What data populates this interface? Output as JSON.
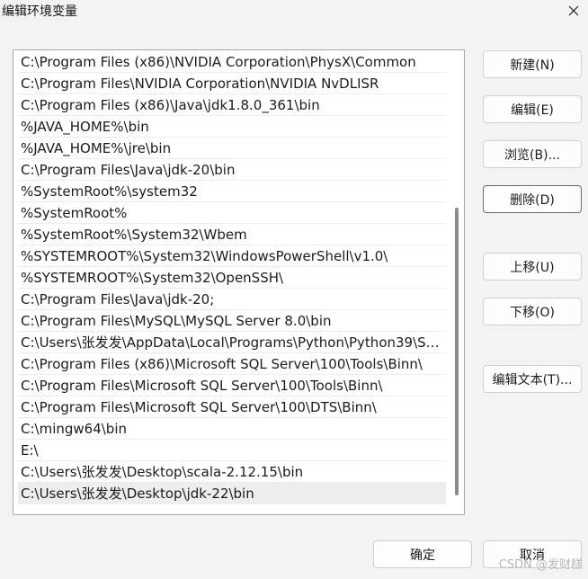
{
  "window": {
    "title": "编辑环境变量"
  },
  "paths": [
    "C:\\Program Files (x86)\\NVIDIA Corporation\\PhysX\\Common",
    "C:\\Program Files\\NVIDIA Corporation\\NVIDIA NvDLISR",
    "C:\\Program Files (x86)\\Java\\jdk1.8.0_361\\bin",
    "%JAVA_HOME%\\bin",
    "%JAVA_HOME%\\jre\\bin",
    "C:\\Program Files\\Java\\jdk-20\\bin",
    "%SystemRoot%\\system32",
    "%SystemRoot%",
    "%SystemRoot%\\System32\\Wbem",
    "%SYSTEMROOT%\\System32\\WindowsPowerShell\\v1.0\\",
    "%SYSTEMROOT%\\System32\\OpenSSH\\",
    "C:\\Program Files\\Java\\jdk-20;",
    "C:\\Program Files\\MySQL\\MySQL Server 8.0\\bin",
    "C:\\Users\\张发发\\AppData\\Local\\Programs\\Python\\Python39\\Sc...",
    "C:\\Program Files (x86)\\Microsoft SQL Server\\100\\Tools\\Binn\\",
    "C:\\Program Files\\Microsoft SQL Server\\100\\Tools\\Binn\\",
    "C:\\Program Files\\Microsoft SQL Server\\100\\DTS\\Binn\\",
    "C:\\mingw64\\bin",
    "E:\\",
    "C:\\Users\\张发发\\Desktop\\scala-2.12.15\\bin",
    "C:\\Users\\张发发\\Desktop\\jdk-22\\bin"
  ],
  "buttons": {
    "new": "新建(N)",
    "edit": "编辑(E)",
    "browse": "浏览(B)...",
    "delete": "删除(D)",
    "move_up": "上移(U)",
    "move_down": "下移(O)",
    "edit_text": "编辑文本(T)...",
    "ok": "确定",
    "cancel": "取消"
  },
  "watermark": "CSDN @发财糕"
}
